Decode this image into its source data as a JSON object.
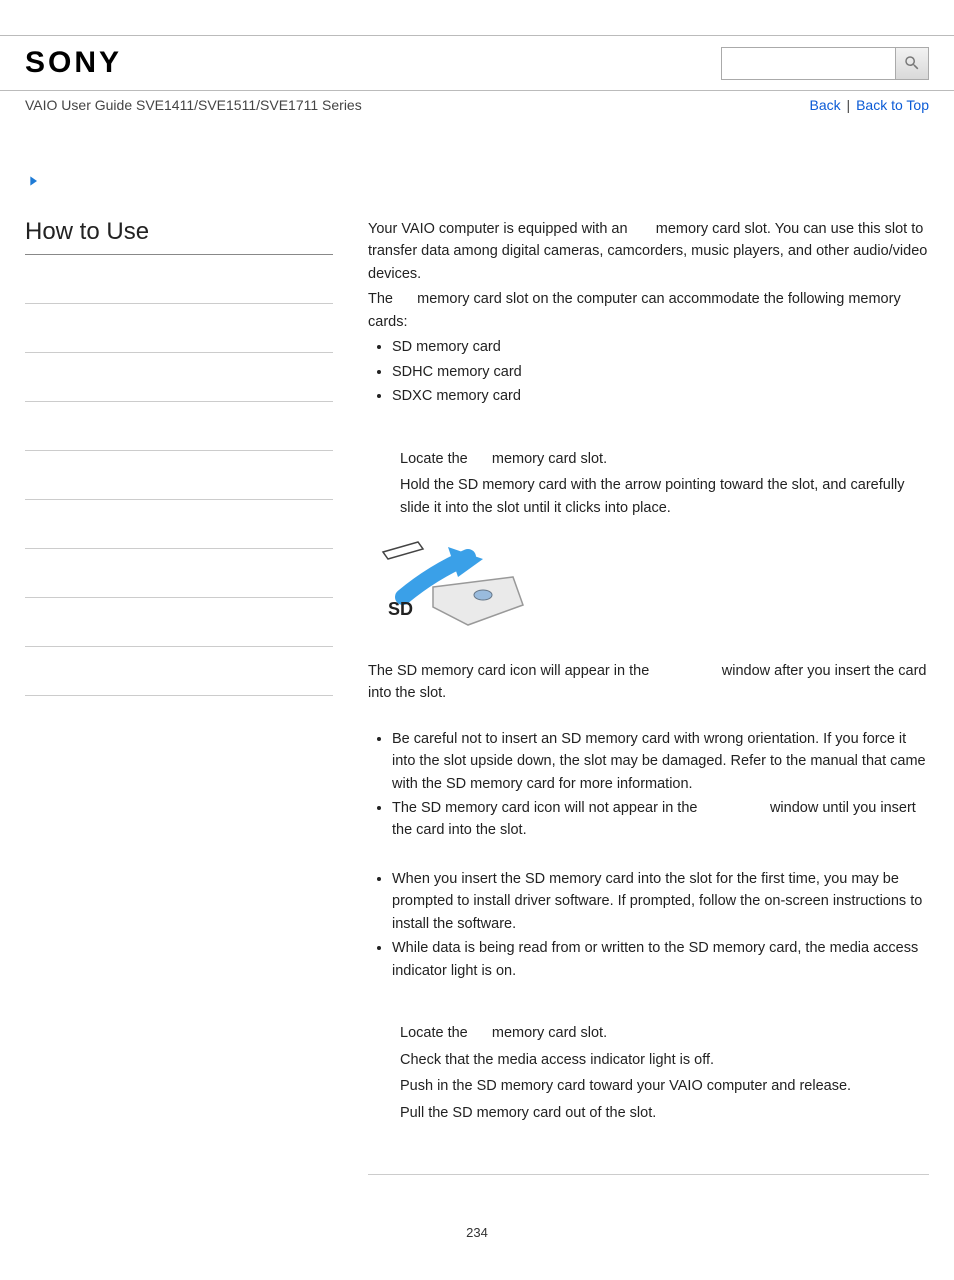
{
  "header": {
    "logo_text": "SONY",
    "breadcrumb": "VAIO User Guide SVE1411/SVE1511/SVE1711 Series",
    "link_back": "Back",
    "link_top": "Back to Top",
    "link_sep": " | "
  },
  "sidebar": {
    "title": "How to Use"
  },
  "content": {
    "intro1": "Your VAIO computer is equipped with an       memory card slot. You can use this slot to transfer data among digital cameras, camcorders, music players, and other audio/video devices.",
    "intro2": "The      memory card slot on the computer can accommodate the following memory cards:",
    "cards": [
      "SD memory card",
      "SDHC memory card",
      "SDXC memory card"
    ],
    "insert_steps": [
      "Locate the      memory card slot.",
      "Hold the SD memory card with the arrow pointing toward the slot, and carefully slide it into the slot until it clicks into place."
    ],
    "after_insert": "The SD memory card icon will appear in the                  window after you insert the card into the slot.",
    "cautions": [
      "Be careful not to insert an SD memory card with wrong orientation. If you force it into the slot upside down, the slot may be damaged. Refer to the manual that came with the SD memory card for more information.",
      "The SD memory card icon will not appear in the                  window until you insert the card into the slot."
    ],
    "notes": [
      "When you insert the SD memory card into the slot for the first time, you may be prompted to install driver software. If prompted, follow the on-screen instructions to install the software.",
      "While data is being read from or written to the SD memory card, the media access indicator light is on."
    ],
    "remove_steps": [
      "Locate the      memory card slot.",
      "Check that the media access indicator light is off.",
      "Push in the SD memory card toward your VAIO computer and release.",
      "Pull the SD memory card out of the slot."
    ],
    "page_number": "234",
    "sd_label": "SD"
  }
}
